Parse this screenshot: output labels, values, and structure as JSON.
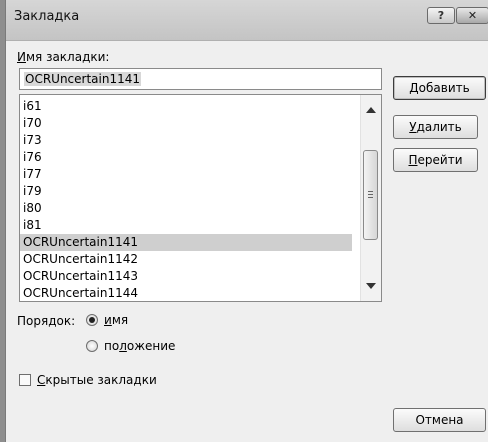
{
  "window": {
    "title": "Закладка",
    "help_button": "?",
    "close_button": "✕"
  },
  "form": {
    "name_label_accel": "И",
    "name_label_rest": "мя закладки:",
    "name_value": "OCRUncertain1141"
  },
  "list": {
    "items": [
      "i61",
      "i70",
      "i73",
      "i76",
      "i77",
      "i79",
      "i80",
      "i81",
      "OCRUncertain1141",
      "OCRUncertain1142",
      "OCRUncertain1143",
      "OCRUncertain1144"
    ],
    "selected_index": 8
  },
  "buttons": {
    "add_accel": "Д",
    "add_rest": "обавить",
    "delete_accel": "У",
    "delete_rest": "далить",
    "goto_accel": "П",
    "goto_rest": "ерейти",
    "cancel": "Отмена"
  },
  "order": {
    "label": "Порядок:",
    "option_name_accel": "и",
    "option_name_rest": "мя",
    "option_position_pre": "по",
    "option_position_accel": "л",
    "option_position_rest": "ожение",
    "selected": "name"
  },
  "hidden": {
    "label_accel": "С",
    "label_rest": "крытые закладки",
    "checked": false
  }
}
